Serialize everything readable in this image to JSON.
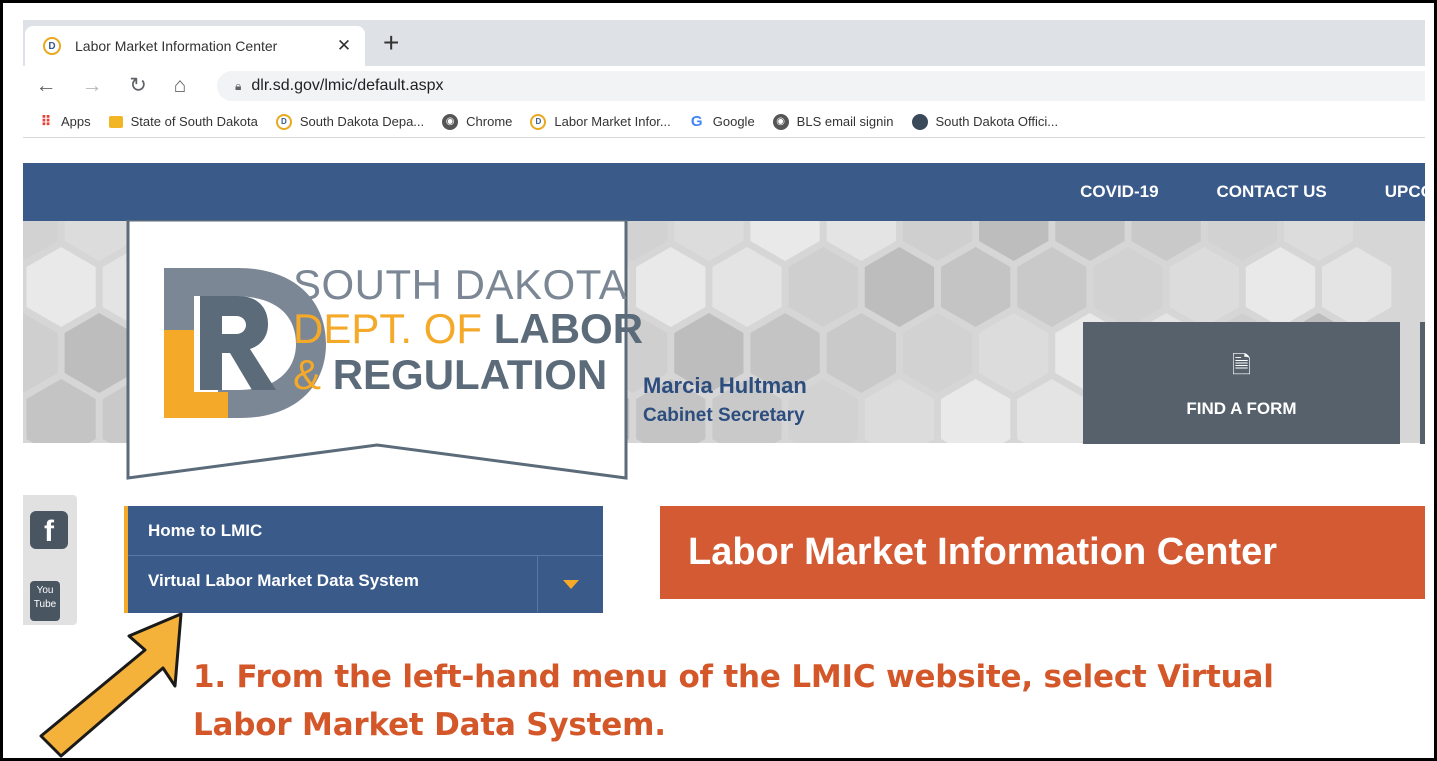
{
  "browser": {
    "tab_title": "Labor Market Information Center",
    "tab_close": "✕",
    "new_tab": "+",
    "url": "dlr.sd.gov/lmic/default.aspx",
    "bookmarks": [
      {
        "label": "Apps",
        "icon": "apps-grid-icon"
      },
      {
        "label": "State of South Dakota",
        "icon": "folder-icon"
      },
      {
        "label": "South Dakota Depa...",
        "icon": "dlr-icon"
      },
      {
        "label": "Chrome",
        "icon": "globe-icon"
      },
      {
        "label": "Labor Market Infor...",
        "icon": "dlr-icon"
      },
      {
        "label": "Google",
        "icon": "google-icon"
      },
      {
        "label": "BLS email signin",
        "icon": "globe-icon"
      },
      {
        "label": "South Dakota Offici...",
        "icon": "sd-seal-icon"
      }
    ]
  },
  "site_nav": {
    "items": [
      "COVID-19",
      "CONTACT US",
      "UPCOMIN"
    ]
  },
  "logo": {
    "line1": "SOUTH DAKOTA",
    "line2_a": "DEPT. OF ",
    "line2_b": "LABOR",
    "line3_a": "& ",
    "line3_b": "REGULATION",
    "letters": "DLR"
  },
  "secretary": {
    "name": "Marcia Hultman",
    "role": "Cabinet Secretary"
  },
  "find_form": {
    "label": "FIND A FORM"
  },
  "social": {
    "facebook": "f",
    "youtube_line1": "You",
    "youtube_line2": "Tube"
  },
  "left_menu": {
    "items": [
      "Home to LMIC",
      "Virtual Labor Market Data System"
    ]
  },
  "page_banner": "Labor Market Information Center",
  "instruction": {
    "line1": "1. From the left-hand menu of the LMIC website, select Virtual",
    "line2": "Labor Market Data System."
  },
  "colors": {
    "nav_blue": "#3a5a8a",
    "gold": "#f4a929",
    "banner_orange": "#d45a34",
    "instruction_orange": "#d4572a",
    "slate": "#56616b"
  }
}
